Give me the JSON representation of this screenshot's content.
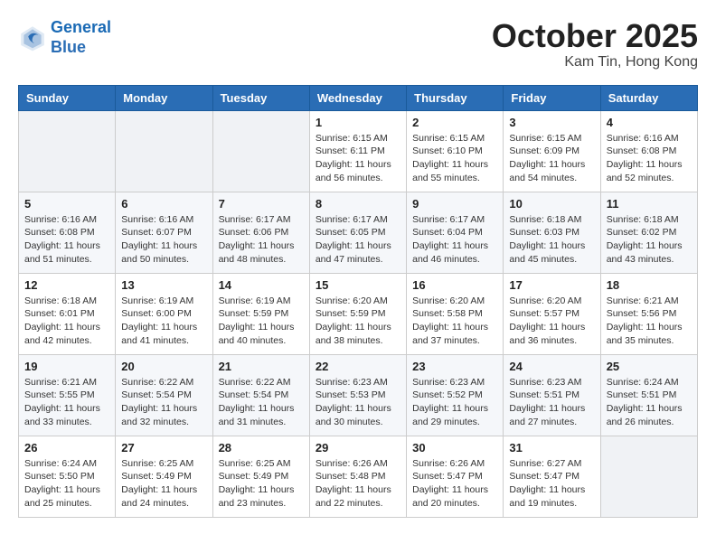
{
  "header": {
    "logo_line1": "General",
    "logo_line2": "Blue",
    "month": "October 2025",
    "location": "Kam Tin, Hong Kong"
  },
  "weekdays": [
    "Sunday",
    "Monday",
    "Tuesday",
    "Wednesday",
    "Thursday",
    "Friday",
    "Saturday"
  ],
  "weeks": [
    [
      {
        "day": "",
        "info": ""
      },
      {
        "day": "",
        "info": ""
      },
      {
        "day": "",
        "info": ""
      },
      {
        "day": "1",
        "info": "Sunrise: 6:15 AM\nSunset: 6:11 PM\nDaylight: 11 hours\nand 56 minutes."
      },
      {
        "day": "2",
        "info": "Sunrise: 6:15 AM\nSunset: 6:10 PM\nDaylight: 11 hours\nand 55 minutes."
      },
      {
        "day": "3",
        "info": "Sunrise: 6:15 AM\nSunset: 6:09 PM\nDaylight: 11 hours\nand 54 minutes."
      },
      {
        "day": "4",
        "info": "Sunrise: 6:16 AM\nSunset: 6:08 PM\nDaylight: 11 hours\nand 52 minutes."
      }
    ],
    [
      {
        "day": "5",
        "info": "Sunrise: 6:16 AM\nSunset: 6:08 PM\nDaylight: 11 hours\nand 51 minutes."
      },
      {
        "day": "6",
        "info": "Sunrise: 6:16 AM\nSunset: 6:07 PM\nDaylight: 11 hours\nand 50 minutes."
      },
      {
        "day": "7",
        "info": "Sunrise: 6:17 AM\nSunset: 6:06 PM\nDaylight: 11 hours\nand 48 minutes."
      },
      {
        "day": "8",
        "info": "Sunrise: 6:17 AM\nSunset: 6:05 PM\nDaylight: 11 hours\nand 47 minutes."
      },
      {
        "day": "9",
        "info": "Sunrise: 6:17 AM\nSunset: 6:04 PM\nDaylight: 11 hours\nand 46 minutes."
      },
      {
        "day": "10",
        "info": "Sunrise: 6:18 AM\nSunset: 6:03 PM\nDaylight: 11 hours\nand 45 minutes."
      },
      {
        "day": "11",
        "info": "Sunrise: 6:18 AM\nSunset: 6:02 PM\nDaylight: 11 hours\nand 43 minutes."
      }
    ],
    [
      {
        "day": "12",
        "info": "Sunrise: 6:18 AM\nSunset: 6:01 PM\nDaylight: 11 hours\nand 42 minutes."
      },
      {
        "day": "13",
        "info": "Sunrise: 6:19 AM\nSunset: 6:00 PM\nDaylight: 11 hours\nand 41 minutes."
      },
      {
        "day": "14",
        "info": "Sunrise: 6:19 AM\nSunset: 5:59 PM\nDaylight: 11 hours\nand 40 minutes."
      },
      {
        "day": "15",
        "info": "Sunrise: 6:20 AM\nSunset: 5:59 PM\nDaylight: 11 hours\nand 38 minutes."
      },
      {
        "day": "16",
        "info": "Sunrise: 6:20 AM\nSunset: 5:58 PM\nDaylight: 11 hours\nand 37 minutes."
      },
      {
        "day": "17",
        "info": "Sunrise: 6:20 AM\nSunset: 5:57 PM\nDaylight: 11 hours\nand 36 minutes."
      },
      {
        "day": "18",
        "info": "Sunrise: 6:21 AM\nSunset: 5:56 PM\nDaylight: 11 hours\nand 35 minutes."
      }
    ],
    [
      {
        "day": "19",
        "info": "Sunrise: 6:21 AM\nSunset: 5:55 PM\nDaylight: 11 hours\nand 33 minutes."
      },
      {
        "day": "20",
        "info": "Sunrise: 6:22 AM\nSunset: 5:54 PM\nDaylight: 11 hours\nand 32 minutes."
      },
      {
        "day": "21",
        "info": "Sunrise: 6:22 AM\nSunset: 5:54 PM\nDaylight: 11 hours\nand 31 minutes."
      },
      {
        "day": "22",
        "info": "Sunrise: 6:23 AM\nSunset: 5:53 PM\nDaylight: 11 hours\nand 30 minutes."
      },
      {
        "day": "23",
        "info": "Sunrise: 6:23 AM\nSunset: 5:52 PM\nDaylight: 11 hours\nand 29 minutes."
      },
      {
        "day": "24",
        "info": "Sunrise: 6:23 AM\nSunset: 5:51 PM\nDaylight: 11 hours\nand 27 minutes."
      },
      {
        "day": "25",
        "info": "Sunrise: 6:24 AM\nSunset: 5:51 PM\nDaylight: 11 hours\nand 26 minutes."
      }
    ],
    [
      {
        "day": "26",
        "info": "Sunrise: 6:24 AM\nSunset: 5:50 PM\nDaylight: 11 hours\nand 25 minutes."
      },
      {
        "day": "27",
        "info": "Sunrise: 6:25 AM\nSunset: 5:49 PM\nDaylight: 11 hours\nand 24 minutes."
      },
      {
        "day": "28",
        "info": "Sunrise: 6:25 AM\nSunset: 5:49 PM\nDaylight: 11 hours\nand 23 minutes."
      },
      {
        "day": "29",
        "info": "Sunrise: 6:26 AM\nSunset: 5:48 PM\nDaylight: 11 hours\nand 22 minutes."
      },
      {
        "day": "30",
        "info": "Sunrise: 6:26 AM\nSunset: 5:47 PM\nDaylight: 11 hours\nand 20 minutes."
      },
      {
        "day": "31",
        "info": "Sunrise: 6:27 AM\nSunset: 5:47 PM\nDaylight: 11 hours\nand 19 minutes."
      },
      {
        "day": "",
        "info": ""
      }
    ]
  ]
}
